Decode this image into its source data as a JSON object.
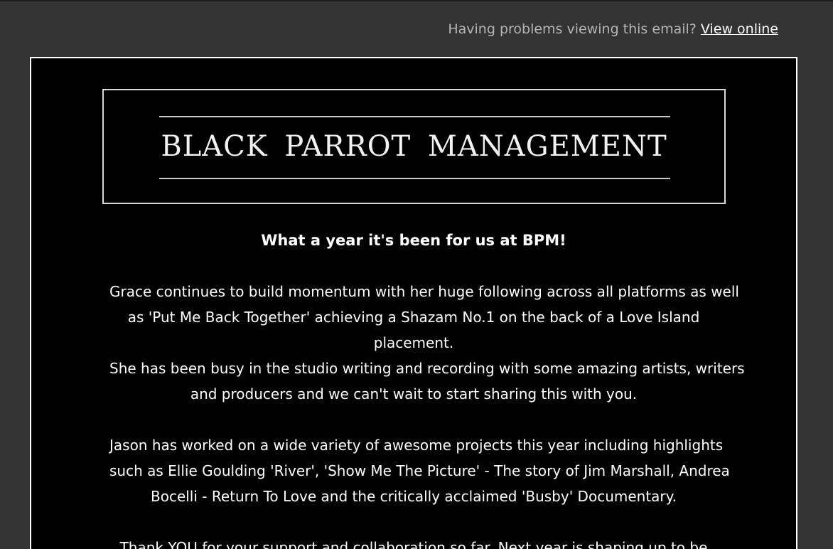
{
  "preheader": {
    "text": "Having problems viewing this email?",
    "link": "View online"
  },
  "logo": {
    "text": "BLACK PARROT MANAGEMENT"
  },
  "content": {
    "headline": "What a year it's been for us at BPM!",
    "paragraphs": [
      {
        "lines": [
          "Grace continues to build momentum with her huge following across all platforms as well",
          "as 'Put Me Back Together' achieving a Shazam No.1 on the back of a Love Island",
          "placement.",
          "She has been busy in the studio writing and recording with some amazing artists, writers",
          "and producers and we can't wait to start sharing this with you."
        ]
      },
      {
        "lines": [
          "Jason has worked on a wide variety of awesome projects this year including highlights",
          "such as Ellie Goulding 'River', 'Show Me The Picture' - The story of Jim Marshall, Andrea",
          "Bocelli - Return To Love and the critically acclaimed 'Busby' Documentary."
        ]
      },
      {
        "lines": [
          "Thank YOU for your support and collaboration so far. Next year is shaping up to be"
        ]
      }
    ]
  }
}
